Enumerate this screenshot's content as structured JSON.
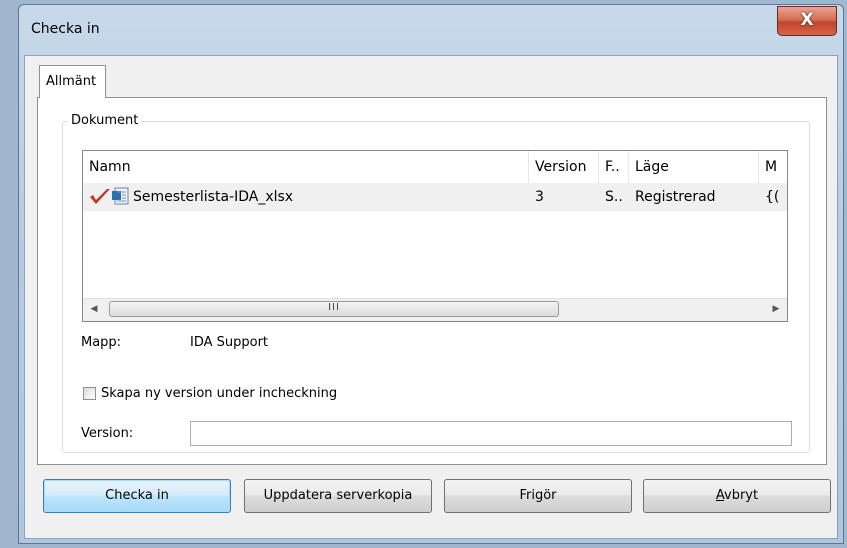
{
  "window": {
    "title": "Checka in",
    "close_label": "X"
  },
  "tabs": [
    {
      "label": "Allmänt",
      "selected": true
    }
  ],
  "document_group": {
    "title": "Dokument",
    "columns": [
      "Namn",
      "Version",
      "F..",
      "Läge",
      "M"
    ],
    "rows": [
      {
        "checked_icon": "red-checkmark-icon",
        "file_icon": "excel-document-icon",
        "name": "Semesterlista-IDA_xlsx",
        "version": "3",
        "f": "S..",
        "status": "Registrerad",
        "m": "{("
      }
    ],
    "scrollbar_grip": "III"
  },
  "folder": {
    "label": "Mapp:",
    "value": "IDA Support"
  },
  "new_version_checkbox": {
    "label": "Skapa ny version under incheckning",
    "checked": false
  },
  "version_field": {
    "label": "Version:",
    "value": ""
  },
  "buttons": {
    "checkin": "Checka in",
    "update": "Uppdatera serverkopia",
    "release": "Frigör",
    "cancel_mnemonic": "A",
    "cancel_rest": "vbryt"
  },
  "colors": {
    "checkmark": "#c0392b",
    "default_button_border": "#3c7fb1",
    "close_button": "#c3452a"
  }
}
